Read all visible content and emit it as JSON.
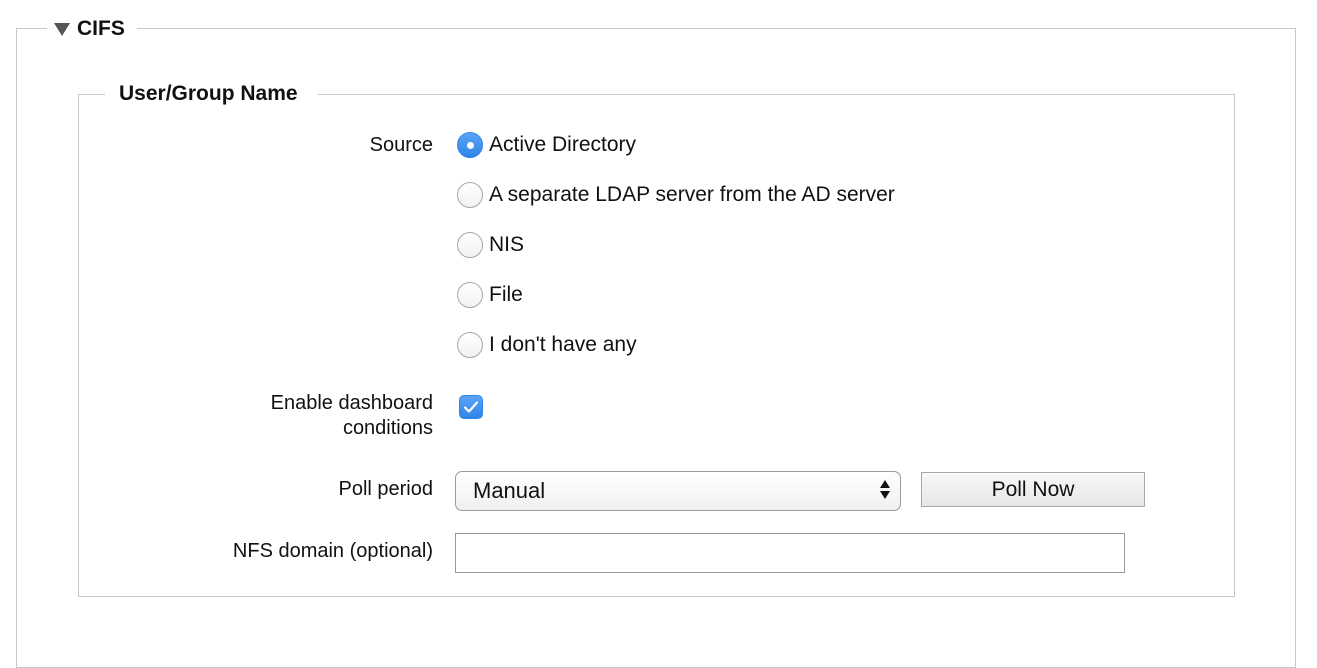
{
  "section": {
    "title": "CIFS",
    "collapse_icon": "triangle-down-icon"
  },
  "user_group": {
    "legend": "User/Group Name",
    "source": {
      "label": "Source",
      "options": [
        {
          "label": "Active Directory",
          "selected": true
        },
        {
          "label": "A separate LDAP server from the AD server",
          "selected": false
        },
        {
          "label": "NIS",
          "selected": false
        },
        {
          "label": "File",
          "selected": false
        },
        {
          "label": "I don't have any",
          "selected": false
        }
      ]
    },
    "dashboard": {
      "label_line1": "Enable dashboard",
      "label_line2": "conditions",
      "checked": true
    },
    "poll": {
      "label": "Poll period",
      "selected_value": "Manual",
      "button_label": "Poll Now"
    },
    "nfs_domain": {
      "label": "NFS domain (optional)",
      "value": "",
      "placeholder": ""
    }
  },
  "colors": {
    "accent": "#2f85e8",
    "border": "#c8c8c8"
  }
}
